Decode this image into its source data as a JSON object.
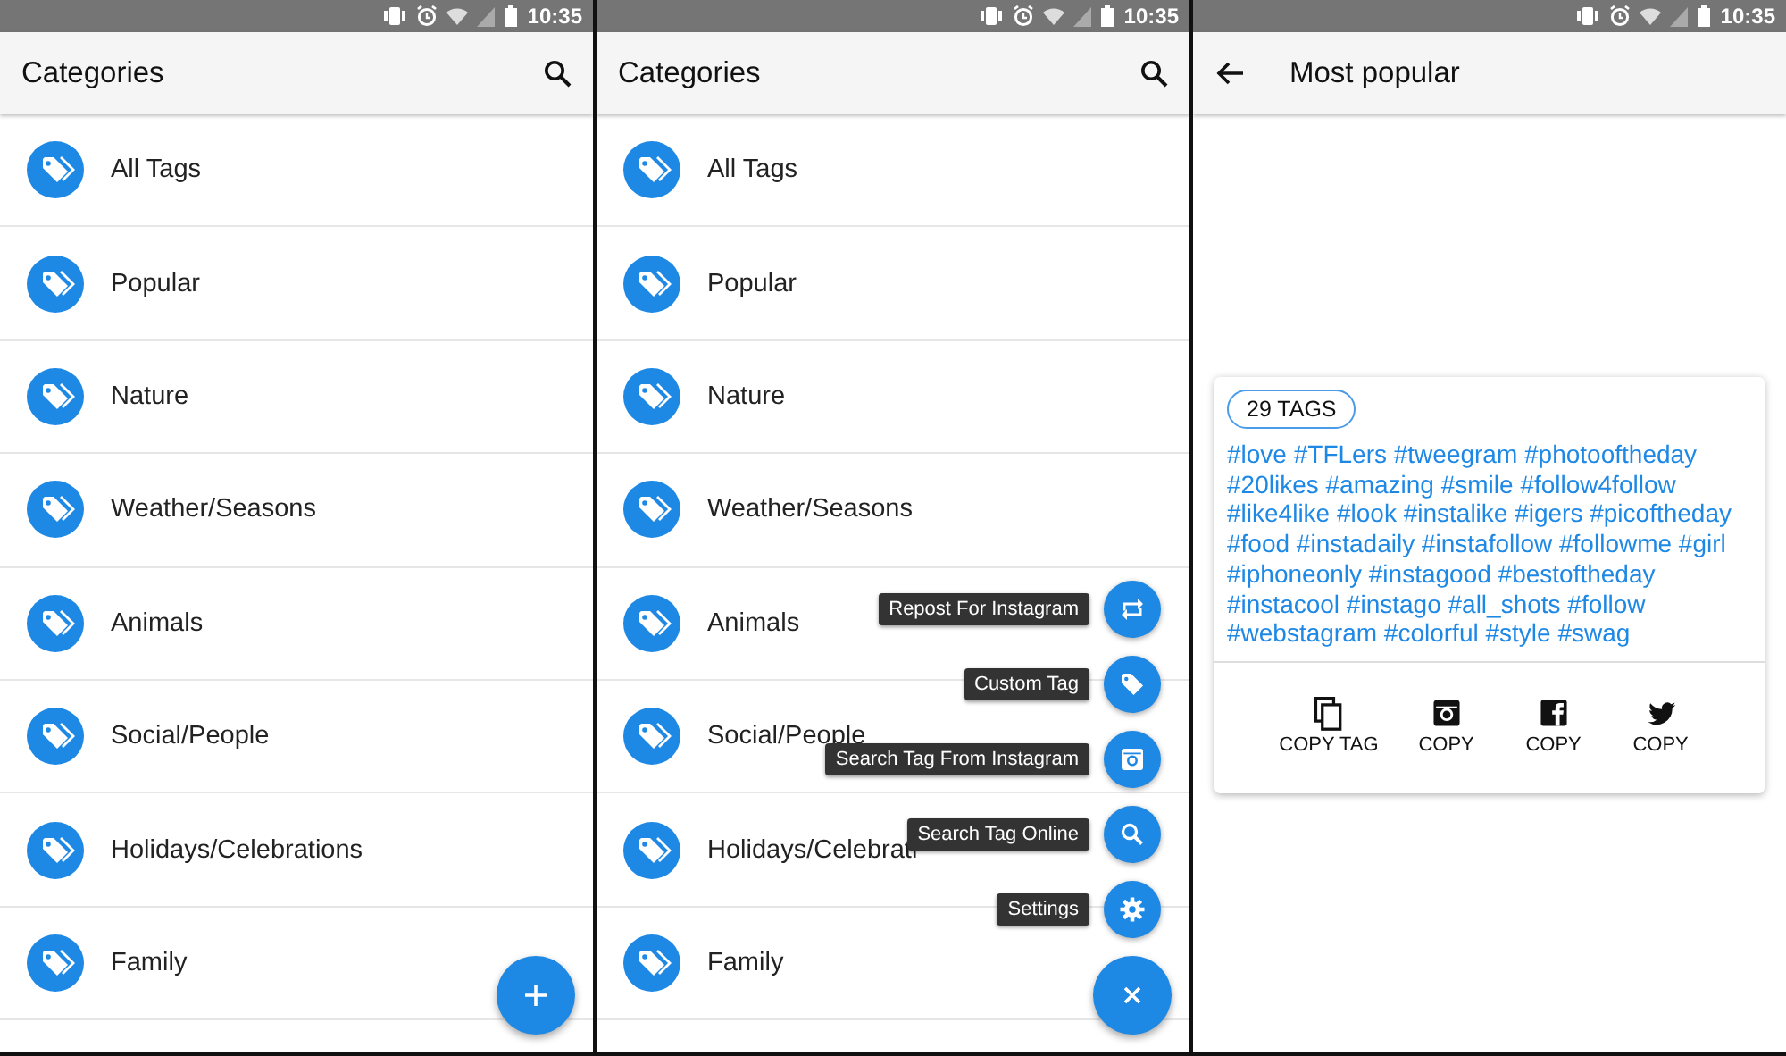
{
  "screens": [
    {
      "kind": "categories",
      "status_bar": {
        "time": "10:35"
      },
      "app_bar": {
        "title": "Categories"
      },
      "categories": [
        {
          "label": "All Tags"
        },
        {
          "label": "Popular"
        },
        {
          "label": "Nature"
        },
        {
          "label": "Weather/Seasons"
        },
        {
          "label": "Animals"
        },
        {
          "label": "Social/People"
        },
        {
          "label": "Holidays/Celebrations"
        },
        {
          "label": "Family"
        }
      ],
      "fab": {
        "expanded": false
      }
    },
    {
      "kind": "categories",
      "status_bar": {
        "time": "10:35"
      },
      "app_bar": {
        "title": "Categories"
      },
      "categories": [
        {
          "label": "All Tags"
        },
        {
          "label": "Popular"
        },
        {
          "label": "Nature"
        },
        {
          "label": "Weather/Seasons"
        },
        {
          "label": "Animals"
        },
        {
          "label": "Social/People"
        },
        {
          "label": "Holidays/Celebrati"
        },
        {
          "label": "Family"
        }
      ],
      "fab": {
        "expanded": true,
        "actions": [
          {
            "kind": "repost",
            "label": "Repost For Instagram"
          },
          {
            "kind": "tag",
            "label": "Custom Tag"
          },
          {
            "kind": "camera",
            "label": "Search Tag From Instagram"
          },
          {
            "kind": "search",
            "label": "Search Tag Online"
          },
          {
            "kind": "settings",
            "label": "Settings"
          }
        ]
      }
    },
    {
      "kind": "tag_detail",
      "status_bar": {
        "time": "10:35"
      },
      "app_bar": {
        "title": "Most popular"
      },
      "card": {
        "count": "29 TAGS",
        "tags": "#love #TFLers #tweegram #photooftheday #20likes #amazing #smile #follow4follow #like4like #look #instalike #igers #picoftheday #food #instadaily #instafollow #followme #girl #iphoneonly #instagood #bestoftheday #instacool #instago #all_shots #follow #webstagram #colorful #style #swag",
        "actions": [
          {
            "kind": "copy",
            "label": "COPY TAG"
          },
          {
            "kind": "camera",
            "label": "COPY"
          },
          {
            "kind": "square_f",
            "label": "COPY"
          },
          {
            "kind": "bird",
            "label": "COPY"
          }
        ]
      }
    }
  ]
}
